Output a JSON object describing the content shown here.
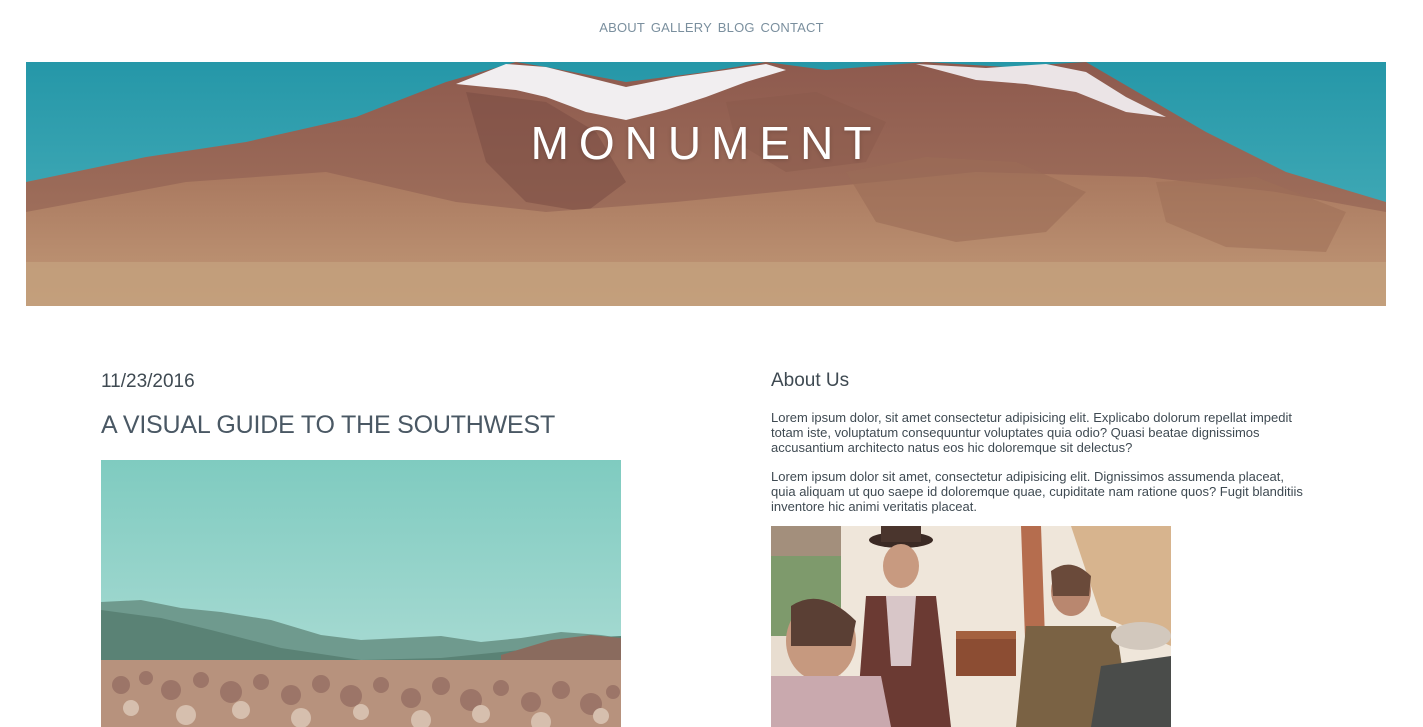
{
  "nav": {
    "items": [
      {
        "label": "ABOUT"
      },
      {
        "label": "GALLERY"
      },
      {
        "label": "BLOG"
      },
      {
        "label": "CONTACT"
      }
    ]
  },
  "hero": {
    "title": "MONUMENT"
  },
  "post": {
    "date": "11/23/2016",
    "title": "A VISUAL GUIDE TO THE SOUTHWEST"
  },
  "about": {
    "heading": "About Us",
    "paragraphs": [
      "Lorem ipsum dolor, sit amet consectetur adipisicing elit. Explicabo dolorum repellat impedit totam iste, voluptatum consequuntur voluptates quia odio? Quasi beatae dignissimos accusantium architecto natus eos hic doloremque sit delectus?",
      "Lorem ipsum dolor sit amet, consectetur adipisicing elit. Dignissimos assumenda placeat, quia aliquam ut quo saepe id doloremque quae, cupiditate nam ratione quos? Fugit blanditiis inventore hic animi veritatis placeat."
    ]
  },
  "colors": {
    "nav_text": "#7a8f9e",
    "body_text": "#3f4a52",
    "sky": "#2a9fae"
  }
}
